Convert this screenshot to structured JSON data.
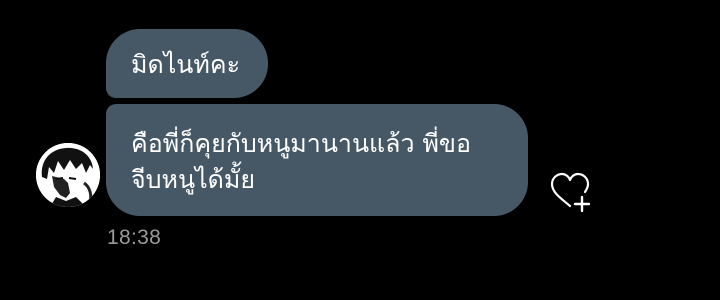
{
  "chat": {
    "messages": [
      {
        "text": "มิดไนท์คะ"
      },
      {
        "text": "คือพี่ก็คุยกับหนูมานานแล้ว พี่ขอจีบหนูได้มั้ย"
      }
    ],
    "timestamp": "18:38"
  },
  "icons": {
    "like": "heart-plus-icon",
    "avatar": "avatar-sketch"
  },
  "colors": {
    "background": "#000000",
    "bubble": "#465866",
    "text": "#ffffff",
    "timestamp": "#9a9a9a"
  }
}
